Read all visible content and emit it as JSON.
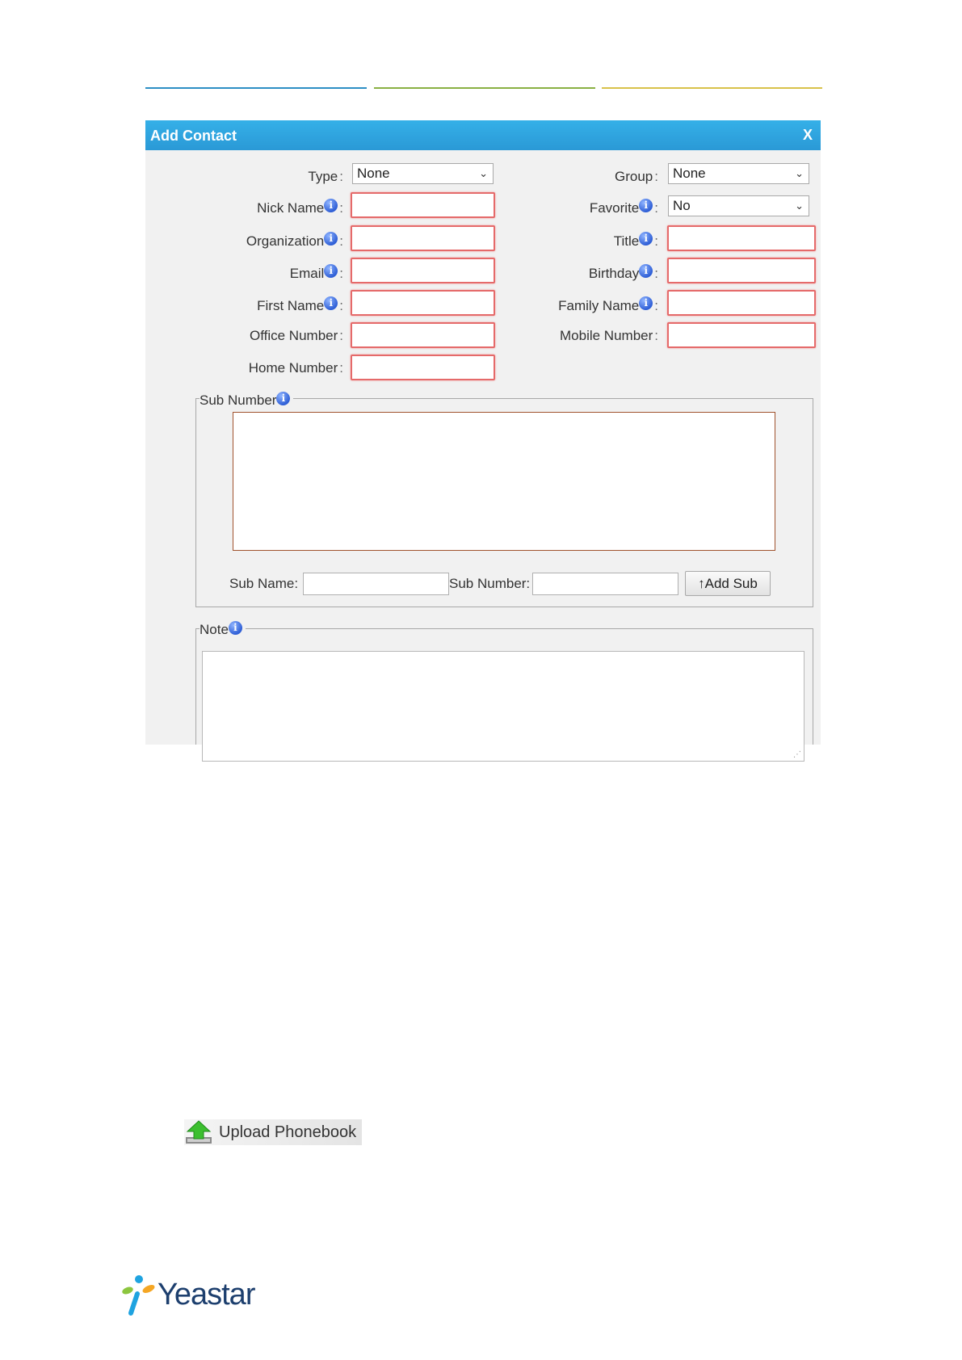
{
  "dialog": {
    "title": "Add Contact",
    "close_label": "X"
  },
  "form": {
    "type_label": "Type",
    "type_value": "None",
    "group_label": "Group",
    "group_value": "None",
    "nick_name_label": "Nick Name",
    "favorite_label": "Favorite",
    "favorite_value": "No",
    "organization_label": "Organization",
    "title_label": "Title",
    "email_label": "Email",
    "birthday_label": "Birthday",
    "first_name_label": "First Name",
    "family_name_label": "Family Name",
    "office_number_label": "Office Number",
    "mobile_number_label": "Mobile Number",
    "home_number_label": "Home Number"
  },
  "sub_number": {
    "legend": "Sub Number",
    "sub_name_label": "Sub Name:",
    "sub_number_label": "Sub Number:",
    "add_sub_label": "↑Add Sub"
  },
  "note": {
    "legend": "Note"
  },
  "upload": {
    "label": "Upload Phonebook"
  },
  "logo": {
    "text": "Yeastar"
  },
  "colors": {
    "accent_blue": "#2a99d6",
    "required_red": "#e56a6a",
    "logo_navy": "#1d3f6e"
  }
}
